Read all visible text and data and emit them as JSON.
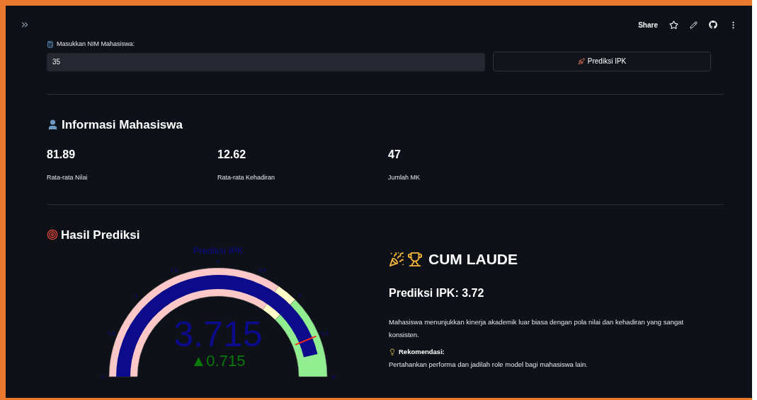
{
  "toolbar": {
    "share": "Share"
  },
  "input": {
    "label": "Masukkan NIM Mahasiswa:",
    "value": "35"
  },
  "predict_button": {
    "label": "Prediksi IPK"
  },
  "info": {
    "heading": "Informasi Mahasiswa",
    "metrics": [
      {
        "value": "81.89",
        "label": "Rata-rata Nilai"
      },
      {
        "value": "12.62",
        "label": "Rata-rata Kehadiran"
      },
      {
        "value": "47",
        "label": "Jumlah MK"
      }
    ]
  },
  "result": {
    "heading": "Hasil Prediksi",
    "gauge": {
      "title": "Prediksi IPK",
      "value": "3.715",
      "delta": "▲0.715",
      "ticks": [
        "0",
        "0.5",
        "1",
        "1.5",
        "2",
        "2.5",
        "3",
        "3.5",
        "4"
      ]
    },
    "status": "CUM LAUDE",
    "prediction": "Prediksi IPK: 3.72",
    "description": "Mahasiswa menunjukkan kinerja akademik luar biasa dengan pola nilai dan kehadiran yang sangat konsisten.",
    "recommendation_label": "Rekomendasi:",
    "recommendation": "Pertahankan performa dan jadilah role model bagi mahasiswa lain."
  }
}
